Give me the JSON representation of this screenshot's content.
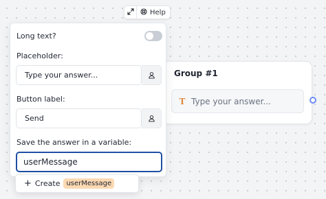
{
  "toolbar": {
    "help_label": "Help",
    "expand_icon": "expand-icon",
    "help_icon": "help-circle-icon"
  },
  "group": {
    "title": "Group #1",
    "block_placeholder": "Type your answer...",
    "block_icon": "text-input-icon",
    "accent_color": "#e08a3c",
    "connector_color": "#6c8cf5"
  },
  "settings": {
    "long_text_label": "Long text?",
    "long_text_enabled": false,
    "placeholder_label": "Placeholder:",
    "placeholder_value": "Type your answer...",
    "button_label_label": "Button label:",
    "button_label_value": "Send",
    "variable_label": "Save the answer in a variable:",
    "variable_value": "userMessage",
    "variable_icon": "user-variable-icon"
  },
  "autocomplete": {
    "create_label": "Create",
    "create_value": "userMessage",
    "tag_color": "#fbd9b3"
  }
}
